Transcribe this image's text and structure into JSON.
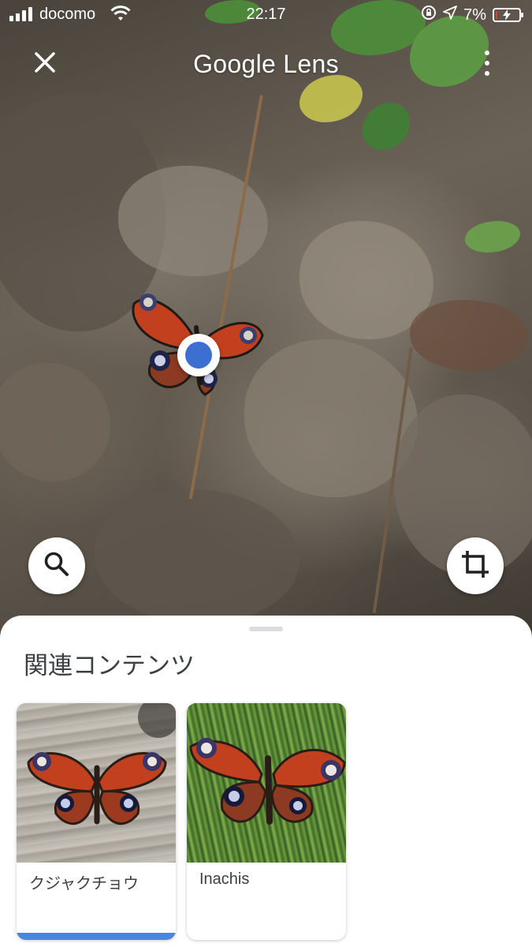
{
  "status_bar": {
    "carrier": "docomo",
    "time": "22:17",
    "battery_percent": "7%",
    "battery_level": 0.07,
    "icons": [
      "signal-icon",
      "wifi-icon",
      "orientation-lock-icon",
      "location-arrow-icon",
      "battery-icon"
    ]
  },
  "header": {
    "title": "Google Lens",
    "close_icon": "close-icon",
    "menu_icon": "more-vert-icon"
  },
  "actions": {
    "search_icon": "search-icon",
    "crop_icon": "crop-icon"
  },
  "sheet": {
    "title": "関連コンテンツ",
    "cards": [
      {
        "label": "クジャクチョウ",
        "image": "peacock-butterfly-on-wood",
        "selected": true
      },
      {
        "label": "Inachis",
        "image": "peacock-butterfly-on-grass",
        "selected": false
      }
    ]
  },
  "colors": {
    "accent_blue": "#3d6fd1",
    "selection_bar": "#4a86e0",
    "butterfly_red": "#c2401e"
  }
}
